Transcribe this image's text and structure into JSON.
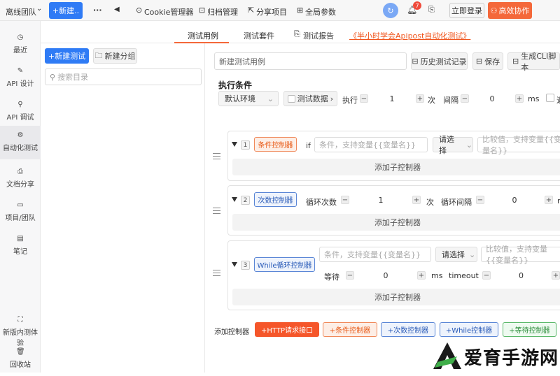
{
  "topbar": {
    "team": "离线团队",
    "new_button": "+新建..",
    "more": "···",
    "back": "◀",
    "cookie": "Cookie管理器",
    "archive": "归档管理",
    "share": "分享项目",
    "globals": "全局参数",
    "notif_count": "7",
    "login": "立即登录",
    "collab": "高效协作"
  },
  "sidebar": {
    "items": [
      {
        "label": "最近"
      },
      {
        "label": "API 设计"
      },
      {
        "label": "API 调试"
      },
      {
        "label": "自动化测试"
      },
      {
        "label": "文档分享"
      },
      {
        "label": "项目/团队"
      },
      {
        "label": "笔记"
      }
    ],
    "beta": "新版内测体验",
    "trash": "回收站"
  },
  "tabs": [
    "测试用例",
    "测试套件",
    "测试报告",
    "《半小时学会Apipost自动化测试》"
  ],
  "tree": {
    "new_test": "+新建测试",
    "new_group": "新建分组",
    "search_placeholder": "搜索目录"
  },
  "main": {
    "name_placeholder": "新建测试用例",
    "history": "历史测试记录",
    "save": "保存",
    "cli": "生成CLI脚本",
    "exec_title": "执行条件",
    "env": "默认环境",
    "test_data": "测试数据",
    "exec_label": "执行",
    "exec_count": "1",
    "times": "次",
    "interval_label": "间隔",
    "interval_value": "0",
    "ms": "ms"
  },
  "controllers": [
    {
      "index": "1",
      "name": "条件控制器",
      "if": "if",
      "cond_placeholder": "条件，支持变量{{变量名}}",
      "select": "请选择",
      "cmp_placeholder": "比较值，支持变量{{变量名}}",
      "add_child": "添加子控制器"
    },
    {
      "index": "2",
      "name": "次数控制器",
      "loop_label": "循环次数",
      "loop_value": "1",
      "times": "次",
      "interval_label": "循环间隔",
      "interval_value": "0",
      "ms": "ms",
      "add_child": "添加子控制器"
    },
    {
      "index": "3",
      "name": "While循环控制器",
      "cond_placeholder": "条件，支持变量{{变量名}}",
      "select": "请选择",
      "cmp_placeholder": "比较值，支持变量{{变量名}}",
      "wait_label": "等待",
      "wait_value": "0",
      "ms": "ms",
      "timeout_label": "timeout",
      "timeout_value": "0",
      "add_child": "添加子控制器"
    }
  ],
  "bottom": {
    "label": "添加控制器",
    "http": "+HTTP请求接口",
    "cond": "+条件控制器",
    "count": "+次数控制器",
    "while": "+While控制器",
    "wait": "+等待控制器"
  },
  "watermark": "爱育手游网"
}
